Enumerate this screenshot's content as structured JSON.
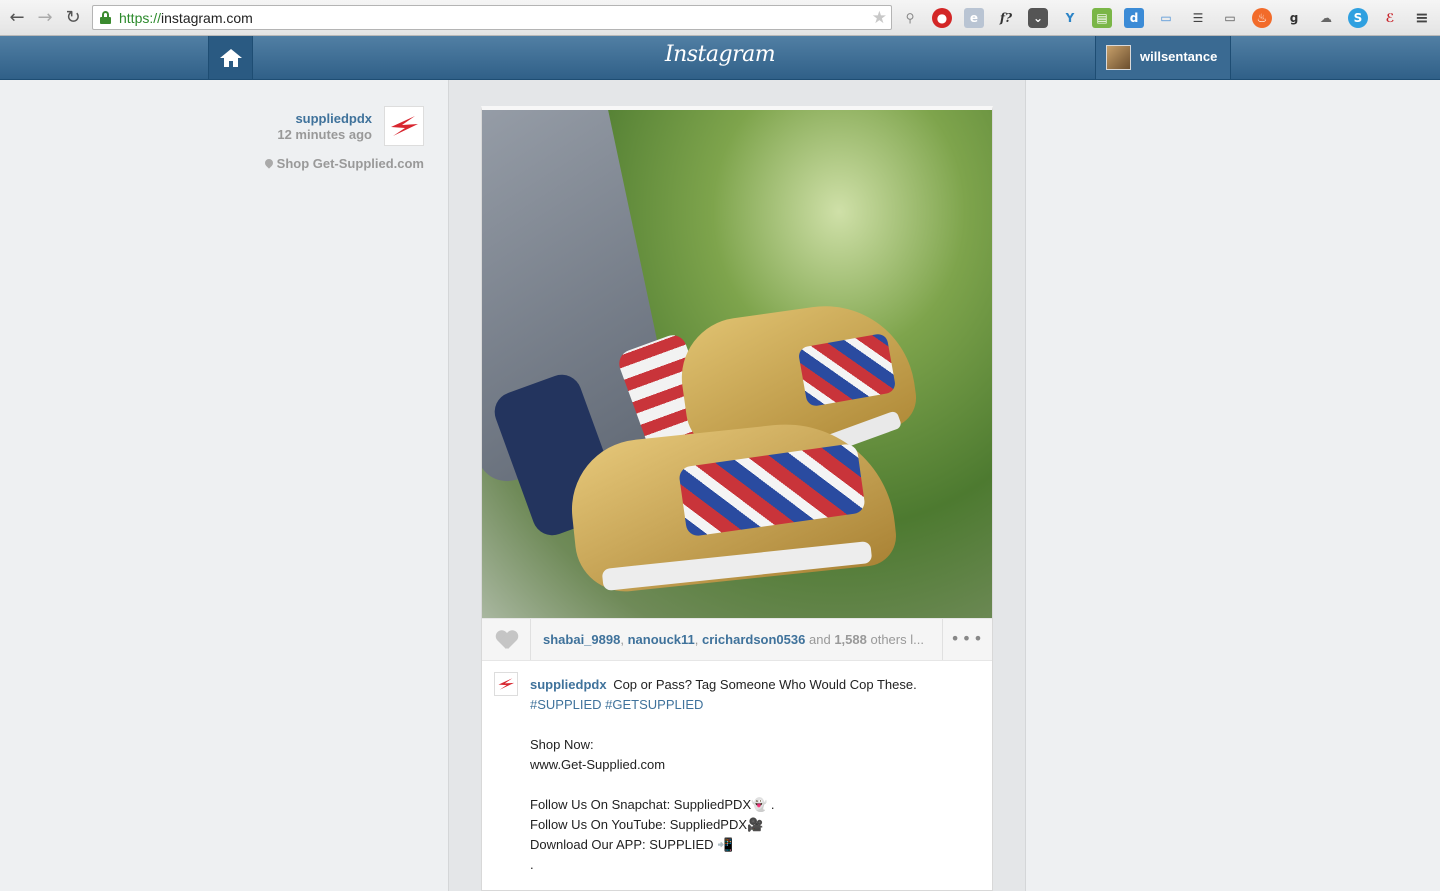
{
  "browser": {
    "back_icon": "←",
    "forward_icon": "→",
    "reload_icon": "↻",
    "url_scheme": "https://",
    "url_host": "instagram.com",
    "bookmark_icon": "★",
    "menu_icon": "≡"
  },
  "header": {
    "logo": "Instagram",
    "username": "willsentance"
  },
  "post": {
    "author": {
      "username": "suppliedpdx",
      "time": "12 minutes ago",
      "location": "Shop Get-Supplied.com"
    },
    "likes": {
      "users": [
        "shabai_9898",
        "nanouck11",
        "crichardson0536"
      ],
      "separator": ", ",
      "and_text": "and",
      "count": "1,588",
      "others_text": "others l..."
    },
    "more_icon": "•••",
    "caption": {
      "username": "suppliedpdx",
      "text": "Cop or Pass? Tag Someone Who Would Cop These.",
      "hashtags": "#SUPPLIED #GETSUPPLIED",
      "shop_label": "Shop Now:",
      "shop_url": "www.Get-Supplied.com",
      "snapchat": "Follow Us On Snapchat: SuppliedPDX👻 .",
      "youtube": "Follow Us On YouTube: SuppliedPDX🎥",
      "app": "Download Our APP: SUPPLIED 📲",
      "dot": "."
    }
  },
  "colors": {
    "link_blue": "#3f729b",
    "bar_blue": "#306088"
  }
}
